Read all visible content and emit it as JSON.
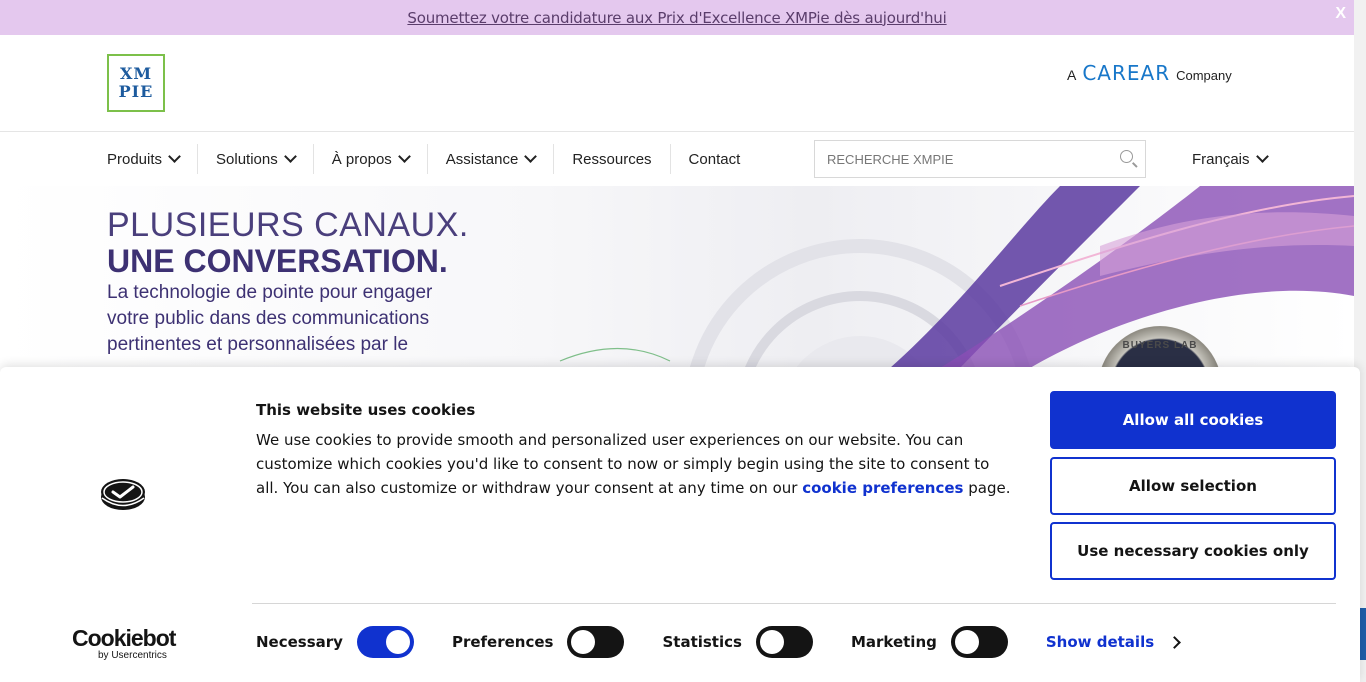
{
  "announcement": {
    "text": "Soumettez votre candidature aux Prix d'Excellence XMPie dès aujourd'hui",
    "close": "X"
  },
  "header": {
    "logo": {
      "line1": "XM",
      "line2": "PIE"
    },
    "partner": {
      "prefix": "A",
      "brand": "CAREAR",
      "suffix": "Company"
    }
  },
  "nav": {
    "items": [
      {
        "label": "Produits",
        "dropdown": true
      },
      {
        "label": "Solutions",
        "dropdown": true
      },
      {
        "label": "À propos",
        "dropdown": true
      },
      {
        "label": "Assistance",
        "dropdown": true
      },
      {
        "label": "Ressources",
        "dropdown": false
      },
      {
        "label": "Contact",
        "dropdown": false
      }
    ],
    "search_placeholder": "RECHERCHE XMPIE",
    "language": "Français"
  },
  "hero": {
    "title_line1": "PLUSIEURS CANAUX.",
    "title_line2": "UNE CONVERSATION.",
    "text": "La technologie de pointe pour engager votre public dans des communications pertinentes et personnalisées par le",
    "badge": "BUYERS LAB"
  },
  "cookie": {
    "title": "This website uses cookies",
    "text_before": "We use cookies to provide smooth and personalized user experiences on our website. You can customize which cookies you'd like to consent to now or simply begin using the site to consent to all. You can also customize or withdraw your consent at any time on our ",
    "link": "cookie preferences",
    "text_after": " page.",
    "buttons": {
      "allow_all": "Allow all cookies",
      "allow_selection": "Allow selection",
      "necessary_only": "Use necessary cookies only"
    },
    "brand": {
      "name": "Cookiebot",
      "by": "by Usercentrics"
    },
    "toggles": [
      {
        "label": "Necessary",
        "on": true
      },
      {
        "label": "Preferences",
        "on": false
      },
      {
        "label": "Statistics",
        "on": false
      },
      {
        "label": "Marketing",
        "on": false
      }
    ],
    "show_details": "Show details"
  },
  "colors": {
    "accent": "#1032cf",
    "announce_bg": "#e4c8ee",
    "hero_text": "#3d3173"
  }
}
